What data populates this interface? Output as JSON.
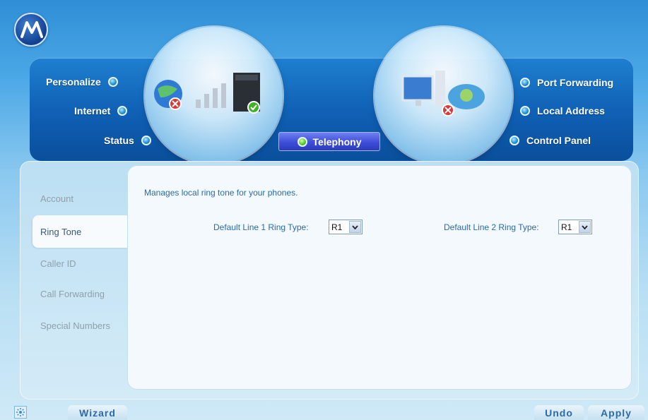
{
  "nav": {
    "left": [
      {
        "label": "Personalize",
        "key": "personalize"
      },
      {
        "label": "Internet",
        "key": "internet"
      },
      {
        "label": "Status",
        "key": "status"
      }
    ],
    "right": [
      {
        "label": "Port Forwarding",
        "key": "port-forwarding"
      },
      {
        "label": "Local Address",
        "key": "local-address"
      },
      {
        "label": "Control Panel",
        "key": "control-panel"
      }
    ],
    "active": {
      "label": "Telephony"
    }
  },
  "side_tabs": [
    {
      "label": "Account"
    },
    {
      "label": "Ring Tone"
    },
    {
      "label": "Caller ID"
    },
    {
      "label": "Call Forwarding"
    },
    {
      "label": "Special Numbers"
    }
  ],
  "active_side_tab": "Ring Tone",
  "main": {
    "description": "Manages local ring tone for your phones.",
    "line1": {
      "label": "Default Line 1 Ring Type:",
      "value": "R1"
    },
    "line2": {
      "label": "Default Line 2 Ring Type:",
      "value": "R1"
    }
  },
  "footer": {
    "wizard": "Wizard",
    "undo": "Undo",
    "apply": "Apply"
  },
  "colors": {
    "accent_blue": "#0f5fb3",
    "active_green": "#4cc524",
    "text_blue": "#2a6aa8"
  }
}
